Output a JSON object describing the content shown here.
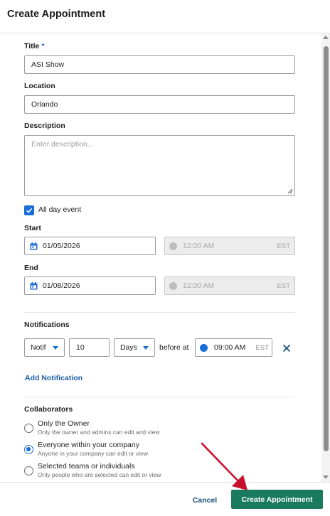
{
  "header": {
    "title": "Create Appointment"
  },
  "form": {
    "title_label": "Title",
    "required_marker": "*",
    "title_value": "ASI Show",
    "location_label": "Location",
    "location_value": "Orlando",
    "description_label": "Description",
    "description_placeholder": "Enter description...",
    "all_day_label": "All day event",
    "all_day_checked": true,
    "start_label": "Start",
    "start_date": "01/05/2026",
    "start_time": "12:00 AM",
    "start_tz": "EST",
    "end_label": "End",
    "end_date": "01/08/2026",
    "end_time": "12:00 AM",
    "end_tz": "EST"
  },
  "notifications": {
    "label": "Notifications",
    "type_value": "Notif",
    "amount_value": "10",
    "unit_value": "Days",
    "before_at_text": "before at",
    "time_value": "09:00 AM",
    "tz": "EST",
    "add_label": "Add Notification"
  },
  "collaborators": {
    "label": "Collaborators",
    "options": [
      {
        "title": "Only the Owner",
        "subtitle": "Only the owner and admins can edit and view",
        "selected": false
      },
      {
        "title": "Everyone within your company",
        "subtitle": "Anyone in your company can edit or view",
        "selected": true
      },
      {
        "title": "Selected teams or individuals",
        "subtitle": "Only people who are selected can edit or view",
        "selected": false
      }
    ]
  },
  "footer": {
    "cancel_label": "Cancel",
    "create_label": "Create Appointment"
  },
  "colors": {
    "accent": "#1a6dd6",
    "primary_button": "#1a7a5e",
    "annotation_arrow": "#c8102e"
  }
}
